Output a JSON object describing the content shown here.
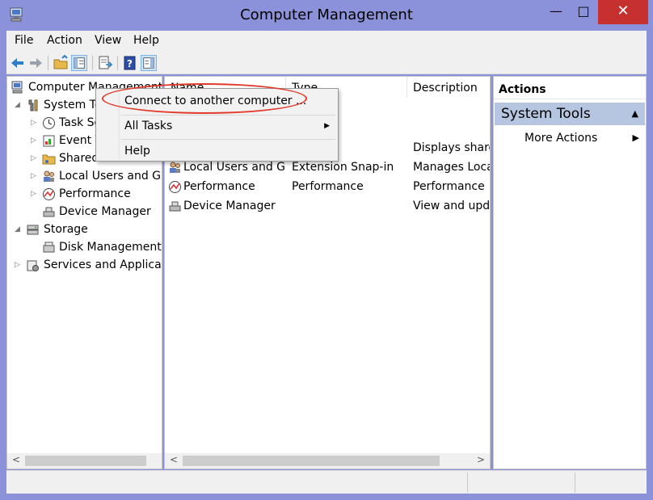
{
  "window": {
    "title": "Computer Management",
    "icon": "computer-management-icon"
  },
  "menubar": [
    "File",
    "Action",
    "View",
    "Help"
  ],
  "tree": {
    "root": "Computer Management (Local)",
    "system_tools": "System Tools",
    "task_scheduler": "Task Scheduler",
    "event_viewer": "Event Viewer",
    "shared_folders": "Shared Folders",
    "local_users": "Local Users and Groups",
    "performance": "Performance",
    "device_manager": "Device Manager",
    "storage": "Storage",
    "disk_management": "Disk Management",
    "services": "Services and Applications"
  },
  "list": {
    "headers": {
      "name": "Name",
      "type": "Type",
      "description": "Description"
    },
    "rows": [
      {
        "name": "",
        "type": "",
        "description": "Displays shared folders"
      },
      {
        "name": "Local Users and Groups",
        "type": "Extension Snap-in",
        "description": "Manages Local Users and Groups"
      },
      {
        "name": "Performance",
        "type": "Performance",
        "description": "Performance"
      },
      {
        "name": "Device Manager",
        "type": "",
        "description": "View and update hardware"
      }
    ]
  },
  "actions": {
    "header": "Actions",
    "group": "System Tools",
    "more": "More Actions"
  },
  "context_menu": {
    "connect": "Connect to another computer ...",
    "all_tasks": "All Tasks",
    "help": "Help"
  },
  "colors": {
    "titlebar": "#8c92d9",
    "close": "#c6302e",
    "highlight": "#b6c6e0",
    "annotation": "#e23a2a"
  }
}
